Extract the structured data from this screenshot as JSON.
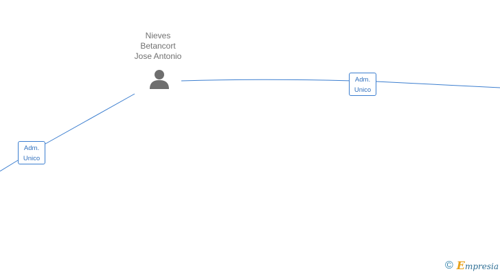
{
  "person": {
    "name_lines": [
      "Nieves",
      "Betancort",
      "Jose Antonio"
    ],
    "icon": "person-silhouette-icon"
  },
  "edges": [
    {
      "id": "right",
      "label_lines": [
        "Adm.",
        "Unico"
      ]
    },
    {
      "id": "left",
      "label_lines": [
        "Adm.",
        "Unico"
      ]
    }
  ],
  "brand": {
    "copyright_symbol": "©",
    "initial": "E",
    "rest": "mpresia"
  },
  "colors": {
    "edge": "#3a7dcf",
    "label_text": "#2f6fbd",
    "person_text": "#707070",
    "person_icon": "#6e6e6e",
    "brand_accent": "#e8a11a",
    "brand_text": "#2d6e94"
  }
}
